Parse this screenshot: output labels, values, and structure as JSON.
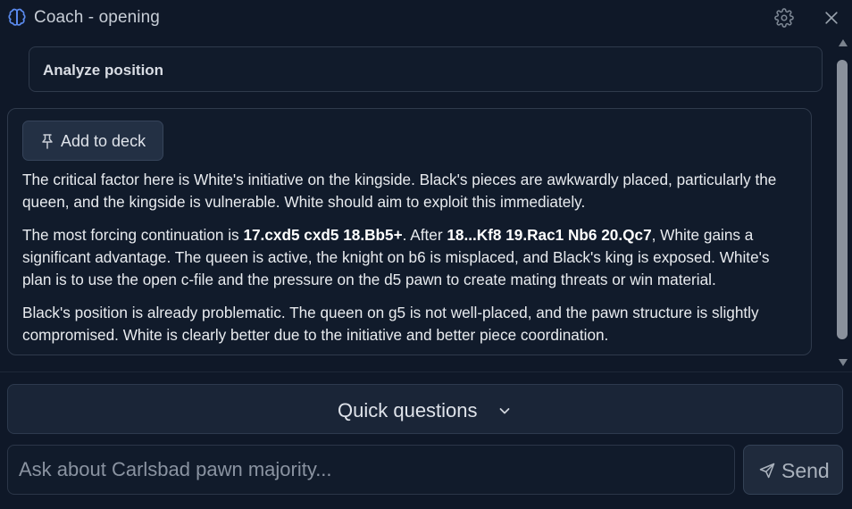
{
  "header": {
    "title": "Coach - opening",
    "icons": {
      "left": "brain-icon",
      "settings": "gear-icon",
      "close": "close-icon"
    }
  },
  "analyze": {
    "label": "Analyze position"
  },
  "answer": {
    "deck_button": {
      "label": "Add to deck",
      "icon": "pin-icon"
    },
    "p1": "The critical factor here is White's initiative on the kingside. Black's pieces are awkwardly placed, particularly the queen, and the kingside is vulnerable. White should aim to exploit this immediately.",
    "p2": {
      "a": "The most forcing continuation is ",
      "b1": "17.cxd5 cxd5 18.Bb5+",
      "c": ". After ",
      "b2": "18...Kf8 19.Rac1 Nb6 20.Qc7",
      "d": ", White gains a significant advantage. The queen is active, the knight on b6 is misplaced, and Black's king is exposed. White's plan is to use the open c-file and the pressure on the d5 pawn to create mating threats or win material."
    },
    "p3": "Black's position is already problematic. The queen on g5 is not well-placed, and the pawn structure is slightly compromised. White is clearly better due to the initiative and better piece coordination."
  },
  "quick": {
    "label": "Quick questions",
    "icon": "chevron-down-icon"
  },
  "input": {
    "placeholder": "Ask about Carlsbad pawn majority...",
    "value": ""
  },
  "send": {
    "label": "Send",
    "icon": "send-icon"
  },
  "colors": {
    "background": "#0f1828",
    "card": "#111b2b",
    "button": "#1a2537",
    "text": "#e6e9ee"
  }
}
